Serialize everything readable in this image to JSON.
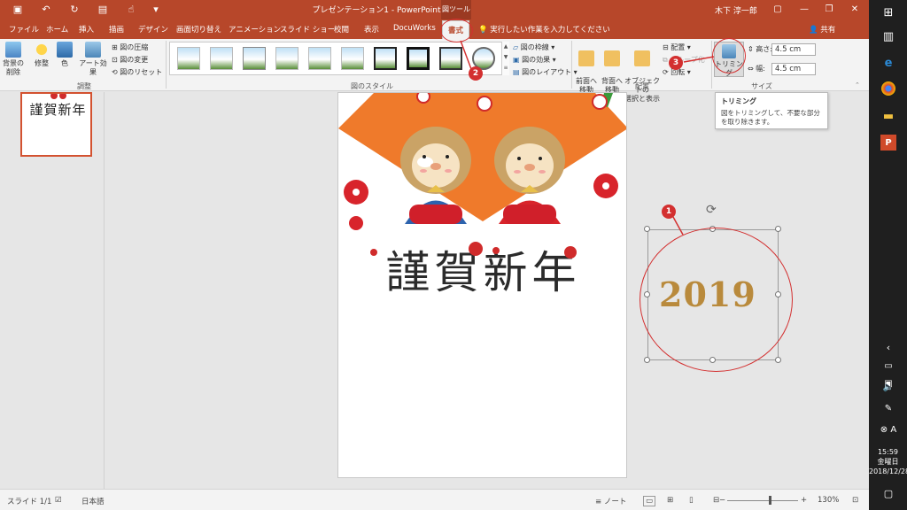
{
  "title_bar": {
    "title": "プレゼンテーション1  -  PowerPoint",
    "context_tab": "図ツール",
    "user": "木下 淳一郎",
    "qat": [
      "save-icon",
      "undo-icon",
      "redo-icon",
      "present-icon",
      "touch-mode-icon",
      "customize-icon"
    ]
  },
  "tabs": [
    "ファイル",
    "ホーム",
    "挿入",
    "描画",
    "デザイン",
    "画面切り替え",
    "アニメーション",
    "スライド ショー",
    "校閲",
    "表示",
    "DocuWorks",
    "書式"
  ],
  "active_tab": "書式",
  "tell_me": "実行したい作業を入力してください",
  "share": "共有",
  "ribbon": {
    "adjust": {
      "remove_bg": "背景の削除",
      "corrections": "修整",
      "color": "色",
      "artistic": "アート効果",
      "compress": "図の圧縮",
      "change": "図の変更",
      "reset": "図のリセット",
      "label": "調整"
    },
    "styles": {
      "border": "図の枠線",
      "effects": "図の効果",
      "layout": "図のレイアウト",
      "label": "図のスタイル"
    },
    "arrange": {
      "bring_forward": "前面へ\n移動",
      "send_backward": "背面へ\n移動",
      "selection_pane": "オブジェクトの\n選択と表示",
      "align": "配置",
      "group": "グループ化",
      "rotate": "回転",
      "label": "配置"
    },
    "size": {
      "crop": "トリミング",
      "height_label": "高さ:",
      "height_value": "4.5 cm",
      "width_label": "幅:",
      "width_value": "4.5 cm",
      "label": "サイズ"
    }
  },
  "tooltip": {
    "title": "トリミング",
    "body": "図をトリミングして、不要な部分を取り除きます。"
  },
  "thumbnail": {
    "number": "1",
    "text": "謹賀新年"
  },
  "slide": {
    "greeting": "謹賀新年"
  },
  "selected_image": {
    "text": "2019"
  },
  "callouts": [
    "1",
    "2",
    "3"
  ],
  "status": {
    "slide": "スライド 1/1",
    "language": "日本語",
    "notes": "ノート",
    "zoom": "130%"
  },
  "taskbar": {
    "time": "15:59",
    "day": "金曜日",
    "date": "2018/12/28"
  },
  "colors": {
    "accent": "#b7472a",
    "callout": "#d32f2f",
    "orange_fan": "#ef7a2b"
  }
}
